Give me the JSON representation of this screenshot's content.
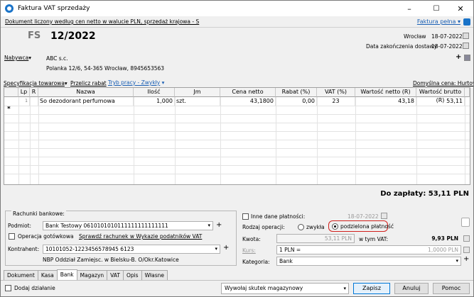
{
  "window": {
    "title": "Faktura VAT sprzedaży",
    "minimize": "–",
    "maximize": "☐",
    "close": "✕"
  },
  "subheader": {
    "doc_info": "Dokument liczony według cen netto w walucie PLN, sprzedaż krajowa - S",
    "mode_link": "Faktura pełna"
  },
  "header": {
    "doc_type": "FS",
    "doc_number": "12/2022",
    "place_label": "Wrocław",
    "date": "18-07-2022",
    "delivery_label": "Data zakończenia dostawy",
    "delivery_date": "18-07-2022",
    "buyer_label": "Nabywca",
    "buyer_name": "ABC s.c.",
    "buyer_address": "Polanka  12/6, 54-365 Wrocław, 8945653563"
  },
  "toolbar": {
    "spec": "Specyfikacja towarowa",
    "discount": "Przelicz rabat",
    "mode": "Tryb pracy - Zwykły",
    "default_price": "Domyślna cena: Hurtowa"
  },
  "table": {
    "columns": [
      "Lp",
      "R",
      "Nazwa",
      "Ilość",
      "Jm",
      "Cena netto",
      "Rabat (%)",
      "VAT (%)",
      "Wartość netto (R)",
      "Wartość brutto (R)"
    ],
    "rows": [
      {
        "lp": "1",
        "r": "",
        "name": "So dezodorant perfumowa",
        "qty": "1,000",
        "jm": "szt.",
        "price": "43,1800",
        "disc": "0,00",
        "vat": "23",
        "net": "43,18",
        "gross": "53,11"
      }
    ],
    "new_row_marker": "*"
  },
  "total": {
    "label": "Do zapłaty: 53,11 PLN"
  },
  "bank": {
    "group_label": "Rachunki bankowe:",
    "entity_label": "Podmiot:",
    "entity_value": "Bank Testowy 0610101010111111111111111",
    "cash_label": "Operacja gotówkowa",
    "check_link": "Sprawdź rachunek w Wykazie podatników VAT",
    "contractor_label": "Kontrahent:",
    "contractor_value": "10101052-1223456578945 6123",
    "bank_info": "NBP Oddział Zamiejsc. w Bielsku-B.  O/Okr.Katowice"
  },
  "payment": {
    "other_label": "Inne dane płatności:",
    "other_date": "18-07-2022",
    "op_label": "Rodzaj operacji:",
    "op_normal": "zwykła",
    "op_split": "podzielona płatność",
    "amount_label": "Kwota:",
    "amount_value": "53,11 PLN",
    "vat_label": "w tym VAT:",
    "vat_value": "9,93 PLN",
    "rate_label": "Kurs:",
    "rate_value": "1 PLN =",
    "rate_result": "1,0000 PLN",
    "category_label": "Kategoria:",
    "category_value": "Bank"
  },
  "tabs": [
    "Dokument",
    "Kasa",
    "Bank",
    "Magazyn",
    "VAT",
    "Opis",
    "Własne"
  ],
  "active_tab": "Bank",
  "footer": {
    "add_action": "Dodaj działanie",
    "warehouse": "Wywołaj skutek magazynowy",
    "save": "Zapisz",
    "cancel": "Anuluj",
    "help": "Pomoc"
  }
}
